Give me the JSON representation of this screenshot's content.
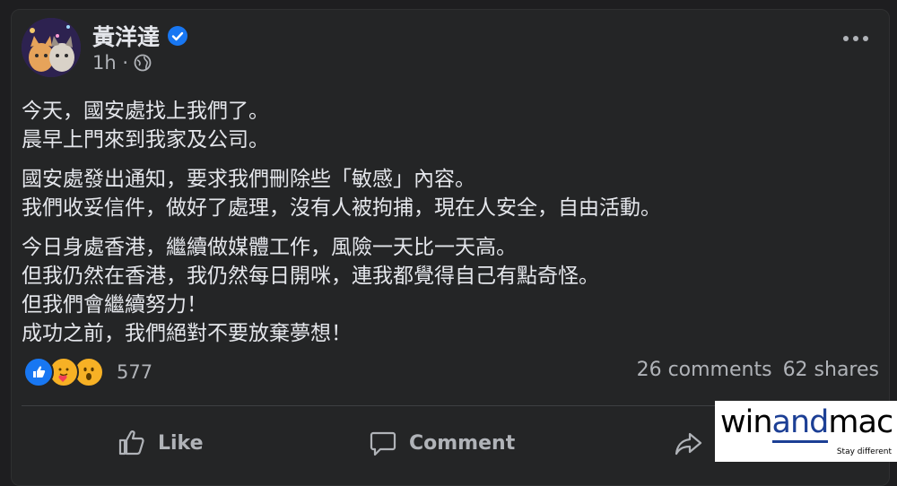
{
  "post": {
    "author": "黃洋達",
    "time": "1h ·",
    "paragraphs": [
      "今天，國安處找上我們了。\n晨早上門來到我家及公司。",
      "國安處發出通知，要求我們刪除些「敏感」內容。\n我們收妥信件，做好了處理，沒有人被拘捕，現在人安全，自由活動。",
      "今日身處香港，繼續做媒體工作，風險一天比一天高。\n但我仍然在香港，我仍然每日開咪，連我都覺得自己有點奇怪。\n但我們會繼續努力！\n成功之前，我們絕對不要放棄夢想！"
    ]
  },
  "engagement": {
    "reaction_count": "577",
    "comments": "26 comments",
    "shares": "62 shares",
    "reactions": [
      "like-icon",
      "care-icon",
      "wow-icon"
    ]
  },
  "actions": {
    "like": "Like",
    "comment": "Comment"
  },
  "watermark": {
    "pre": "win",
    "mid": "and",
    "post": "mac",
    "tagline": "Stay different"
  },
  "colors": {
    "background": "#242526",
    "text": "#e4e6eb",
    "secondary": "#b0b3b8",
    "verified": "#1877f2"
  }
}
